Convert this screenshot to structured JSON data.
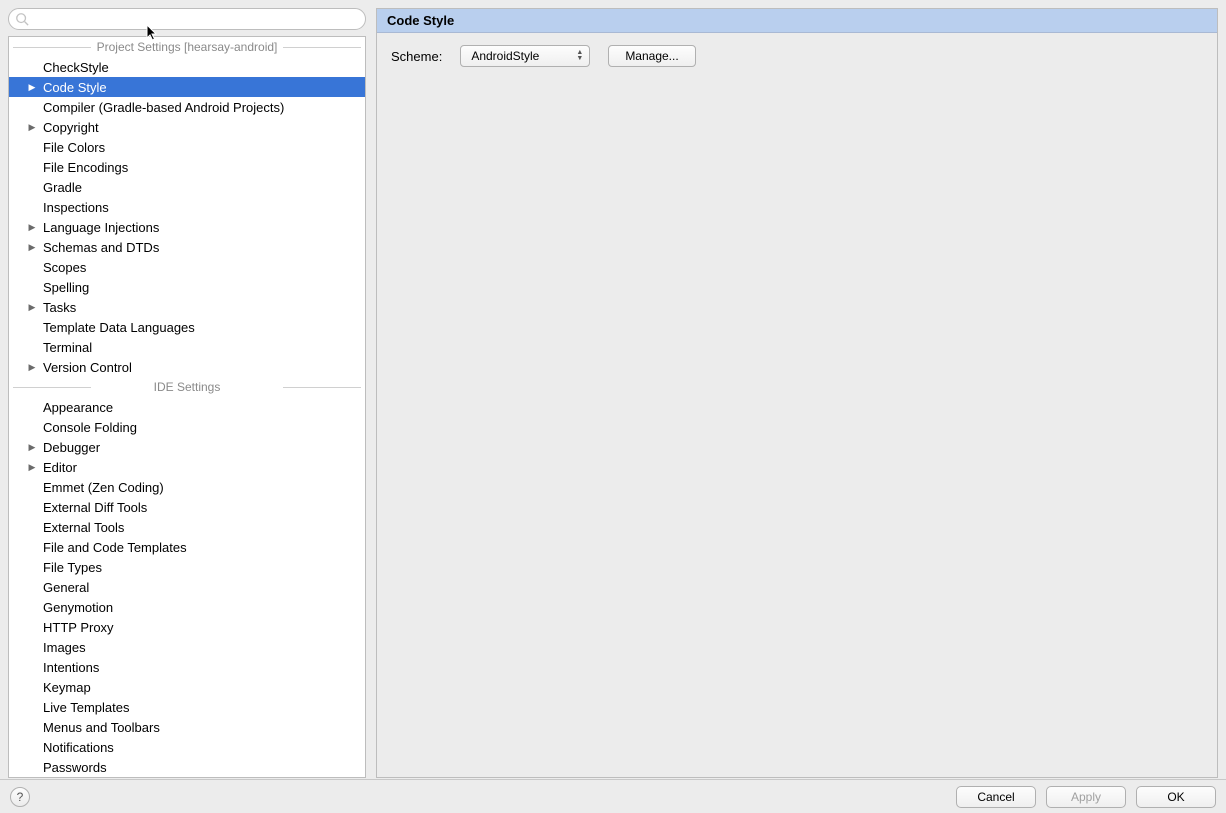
{
  "search": {
    "placeholder": ""
  },
  "sections": {
    "project": "Project Settings [hearsay-android]",
    "ide": "IDE Settings"
  },
  "tree": {
    "project": [
      {
        "label": "CheckStyle",
        "expandable": false,
        "selected": false
      },
      {
        "label": "Code Style",
        "expandable": true,
        "selected": true
      },
      {
        "label": "Compiler (Gradle-based Android Projects)",
        "expandable": false,
        "selected": false
      },
      {
        "label": "Copyright",
        "expandable": true,
        "selected": false
      },
      {
        "label": "File Colors",
        "expandable": false,
        "selected": false
      },
      {
        "label": "File Encodings",
        "expandable": false,
        "selected": false
      },
      {
        "label": "Gradle",
        "expandable": false,
        "selected": false
      },
      {
        "label": "Inspections",
        "expandable": false,
        "selected": false
      },
      {
        "label": "Language Injections",
        "expandable": true,
        "selected": false
      },
      {
        "label": "Schemas and DTDs",
        "expandable": true,
        "selected": false
      },
      {
        "label": "Scopes",
        "expandable": false,
        "selected": false
      },
      {
        "label": "Spelling",
        "expandable": false,
        "selected": false
      },
      {
        "label": "Tasks",
        "expandable": true,
        "selected": false
      },
      {
        "label": "Template Data Languages",
        "expandable": false,
        "selected": false
      },
      {
        "label": "Terminal",
        "expandable": false,
        "selected": false
      },
      {
        "label": "Version Control",
        "expandable": true,
        "selected": false
      }
    ],
    "ide": [
      {
        "label": "Appearance",
        "expandable": false
      },
      {
        "label": "Console Folding",
        "expandable": false
      },
      {
        "label": "Debugger",
        "expandable": true
      },
      {
        "label": "Editor",
        "expandable": true
      },
      {
        "label": "Emmet (Zen Coding)",
        "expandable": false
      },
      {
        "label": "External Diff Tools",
        "expandable": false
      },
      {
        "label": "External Tools",
        "expandable": false
      },
      {
        "label": "File and Code Templates",
        "expandable": false
      },
      {
        "label": "File Types",
        "expandable": false
      },
      {
        "label": "General",
        "expandable": false
      },
      {
        "label": "Genymotion",
        "expandable": false
      },
      {
        "label": "HTTP Proxy",
        "expandable": false
      },
      {
        "label": "Images",
        "expandable": false
      },
      {
        "label": "Intentions",
        "expandable": false
      },
      {
        "label": "Keymap",
        "expandable": false
      },
      {
        "label": "Live Templates",
        "expandable": false
      },
      {
        "label": "Menus and Toolbars",
        "expandable": false
      },
      {
        "label": "Notifications",
        "expandable": false
      },
      {
        "label": "Passwords",
        "expandable": false
      }
    ]
  },
  "panel": {
    "title": "Code Style",
    "scheme_label": "Scheme:",
    "scheme_value": "AndroidStyle",
    "manage_label": "Manage..."
  },
  "footer": {
    "help": "?",
    "cancel": "Cancel",
    "apply": "Apply",
    "ok": "OK"
  }
}
